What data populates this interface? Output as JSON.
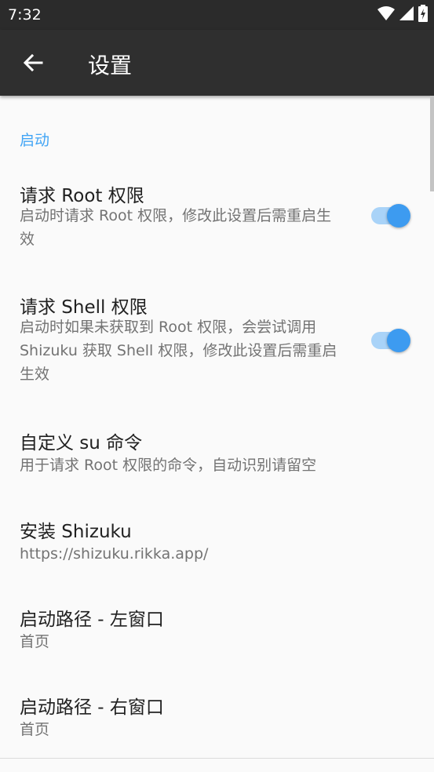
{
  "status_bar": {
    "time": "7:32"
  },
  "app_bar": {
    "title": "设置"
  },
  "section": {
    "title": "启动"
  },
  "prefs": [
    {
      "title": "请求 Root 权限",
      "summary": "启动时请求 Root 权限，修改此设置后需重启生效",
      "toggle_on": true
    },
    {
      "title": "请求 Shell 权限",
      "summary": "启动时如果未获取到 Root 权限，会尝试调用 Shizuku 获取 Shell 权限，修改此设置后需重启生效",
      "toggle_on": true
    },
    {
      "title": "自定义 su 命令",
      "summary": "用于请求 Root 权限的命令，自动识别请留空"
    },
    {
      "title": "安装 Shizuku",
      "summary": "https://shizuku.rikka.app/"
    },
    {
      "title": "启动路径 - 左窗口",
      "summary": "首页"
    },
    {
      "title": "启动路径 - 右窗口",
      "summary": "首页"
    }
  ],
  "colors": {
    "accent": "#42a5f5",
    "toggle_thumb": "#3d9bf0",
    "toggle_track": "#a9d3f8",
    "app_bar": "#2f2f2f"
  }
}
